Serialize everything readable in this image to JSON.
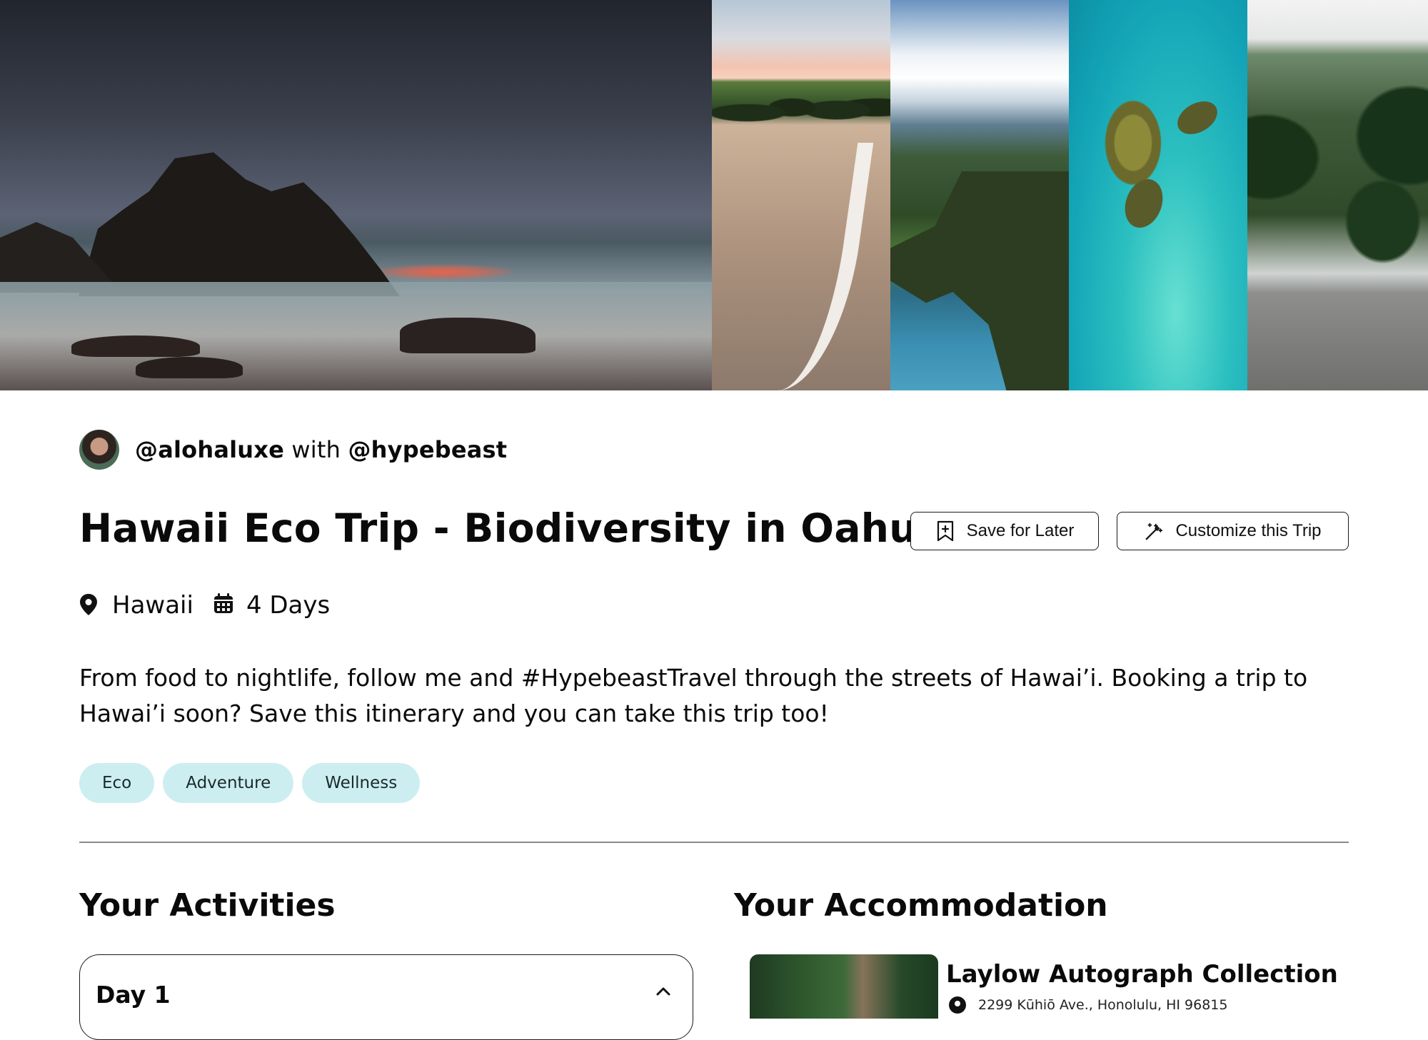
{
  "author": {
    "primary_handle": "@alohaluxe",
    "connector": "with",
    "secondary_handle": "@hypebeast"
  },
  "trip": {
    "title": "Hawaii Eco Trip - Biodiversity in Oahu",
    "location": "Hawaii",
    "duration": "4 Days",
    "description": "From food to nightlife, follow me and #HypebeastTravel through the streets of Hawai’i. Booking a trip to Hawai’i soon? Save this itinerary and you can take this trip too!",
    "tags": [
      "Eco",
      "Adventure",
      "Wellness"
    ]
  },
  "actions": {
    "save_label": "Save for Later",
    "customize_label": "Customize this Trip"
  },
  "activities": {
    "heading": "Your Activities",
    "days": [
      {
        "label": "Day 1",
        "expanded": true
      }
    ]
  },
  "accommodation": {
    "heading": "Your Accommodation",
    "name": "Laylow Autograph Collection",
    "address": "2299 Kūhiō Ave., Honolulu, HI 96815"
  },
  "icons": {
    "save": "bookmark-plus-icon",
    "customize": "magic-wand-icon",
    "location": "map-pin-icon",
    "duration": "calendar-icon",
    "collapse": "chevron-up-icon",
    "address": "map-pin-icon"
  },
  "colors": {
    "tag_background": "#cdeef0",
    "text": "#0a0a0a",
    "divider": "#8a8a8a"
  }
}
